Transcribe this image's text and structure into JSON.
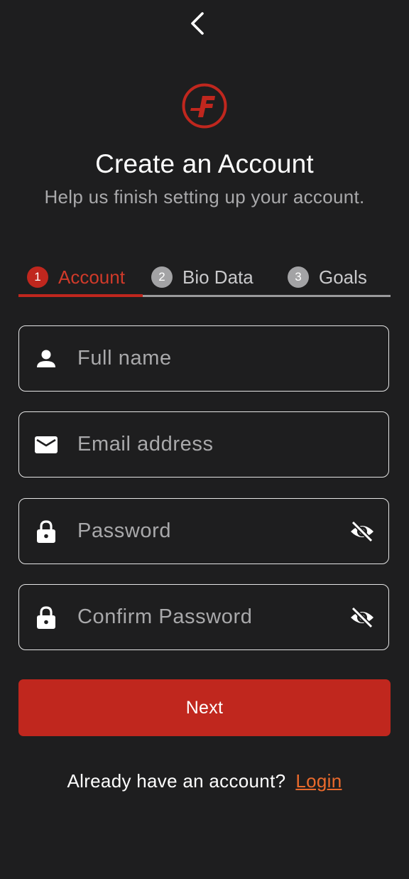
{
  "header": {
    "back_icon": "chevron-left-icon",
    "logo_icon": "f-logo-icon",
    "title": "Create an Account",
    "subtitle": "Help us finish setting up your account."
  },
  "steps": [
    {
      "number": "1",
      "label": "Account",
      "active": true
    },
    {
      "number": "2",
      "label": "Bio Data",
      "active": false
    },
    {
      "number": "3",
      "label": "Goals",
      "active": false
    }
  ],
  "form": {
    "full_name": {
      "placeholder": "Full name",
      "value": "",
      "icon": "person-icon"
    },
    "email": {
      "placeholder": "Email address",
      "value": "",
      "icon": "mail-icon"
    },
    "password": {
      "placeholder": "Password",
      "value": "",
      "icon": "lock-icon",
      "toggle_icon": "eye-off-icon"
    },
    "confirm_password": {
      "placeholder": "Confirm Password",
      "value": "",
      "icon": "lock-icon",
      "toggle_icon": "eye-off-icon"
    }
  },
  "next_label": "Next",
  "footer": {
    "prompt": "Already have an account?",
    "login_label": "Login"
  },
  "colors": {
    "background": "#1e1e1f",
    "accent": "#c0271e",
    "link": "#ea6a2c",
    "muted": "#a9a9ab"
  }
}
